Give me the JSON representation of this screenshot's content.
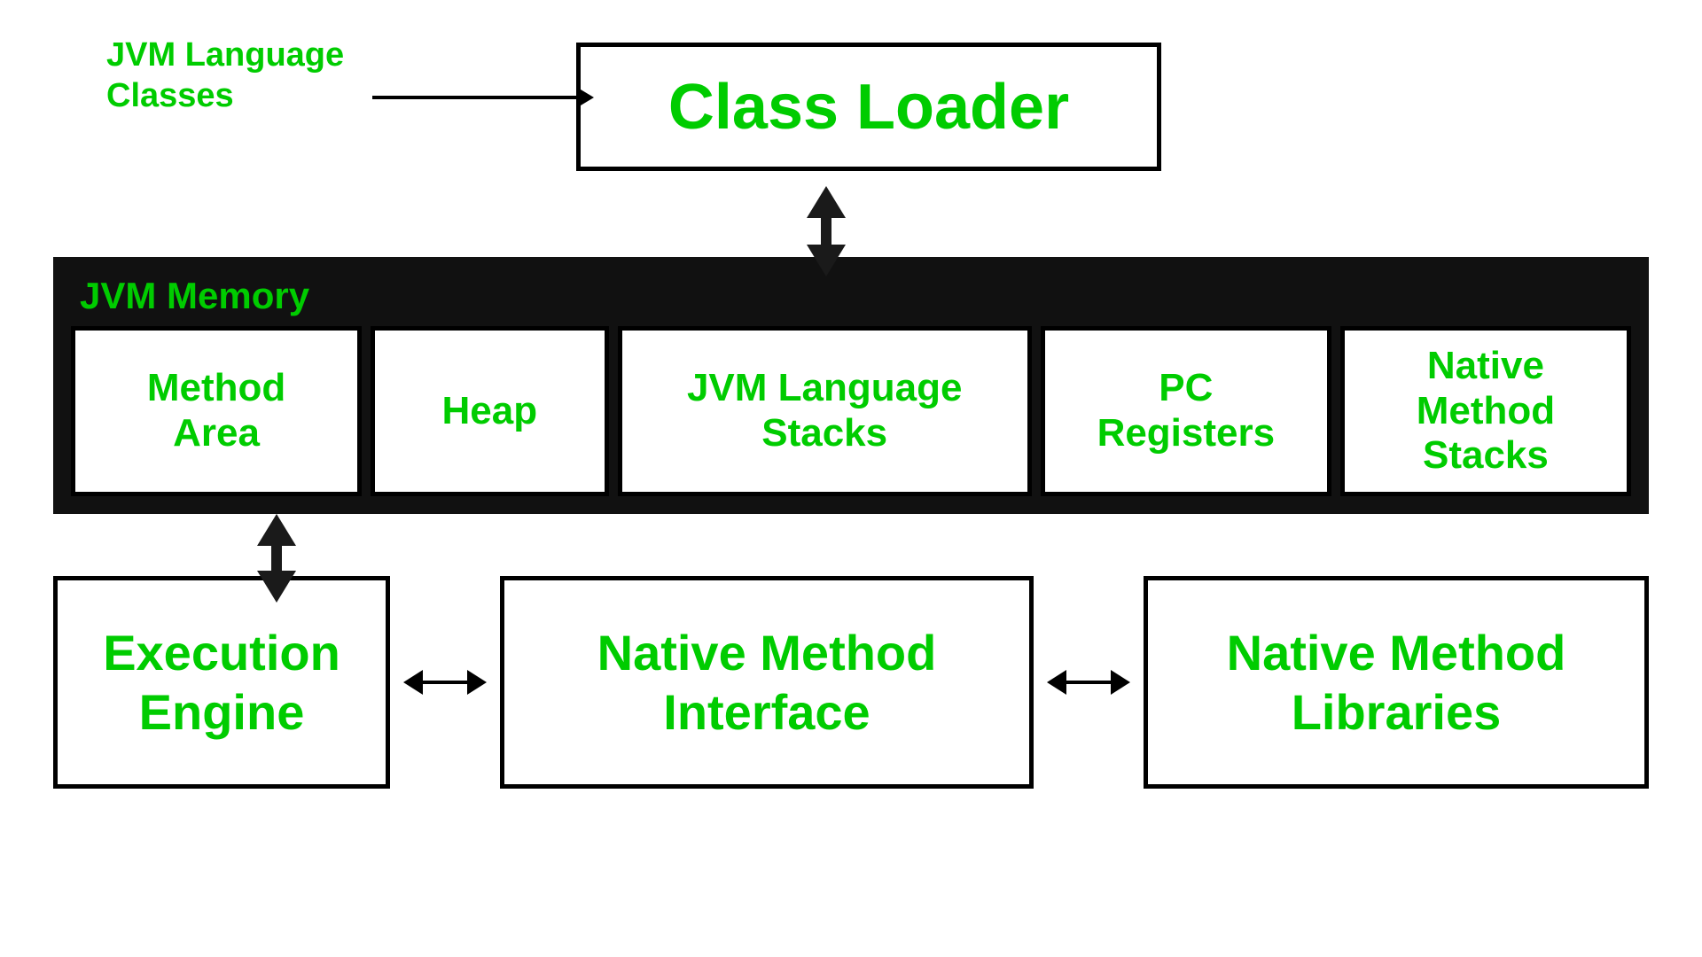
{
  "jvm_label": {
    "line1": "JVM Language",
    "line2": "Classes"
  },
  "class_loader": {
    "label": "Class Loader"
  },
  "jvm_memory": {
    "title": "JVM Memory",
    "boxes": [
      {
        "id": "method-area",
        "label": "Method\nArea"
      },
      {
        "id": "heap",
        "label": "Heap"
      },
      {
        "id": "jvm-stacks",
        "label": "JVM Language\nStacks"
      },
      {
        "id": "pc-registers",
        "label": "PC\nRegisters"
      },
      {
        "id": "native-stacks",
        "label": "Native\nMethod\nStacks"
      }
    ]
  },
  "bottom": {
    "execution_engine": "Execution\nEngine",
    "native_method_interface": "Native Method\nInterface",
    "native_method_libraries": "Native Method\nLibraries"
  },
  "colors": {
    "green": "#00cc00",
    "black": "#000000",
    "dark": "#111111"
  }
}
